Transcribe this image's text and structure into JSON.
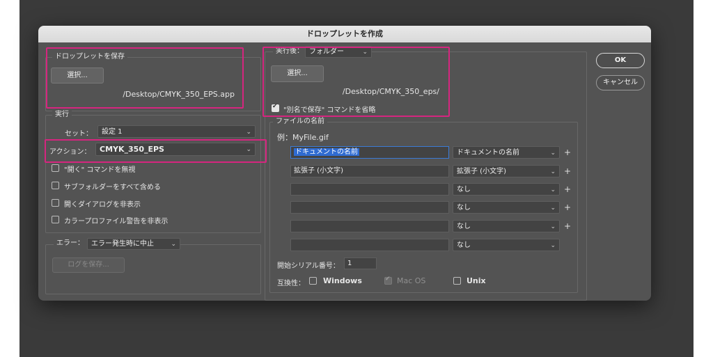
{
  "dialog": {
    "title": "ドロップレットを作成"
  },
  "save_droplet": {
    "legend": "ドロップレットを保存",
    "choose_label": "選択...",
    "path": "/Desktop/CMYK_350_EPS.app"
  },
  "run": {
    "legend": "実行",
    "set_label": "セット：",
    "set_value": "設定 1",
    "action_label": "アクション：",
    "action_value": "CMYK_350_EPS",
    "options": [
      "\"開く\" コマンドを無視",
      "サブフォルダーをすべて含める",
      "開くダイアログを非表示",
      "カラープロファイル警告を非表示"
    ]
  },
  "error": {
    "label": "エラー：",
    "value": "エラー発生時に中止",
    "log_button": "ログを保存..."
  },
  "destination": {
    "label": "実行後：",
    "value": "フォルダー",
    "choose_label": "選択...",
    "path": "/Desktop/CMYK_350_eps/",
    "override_label": "\"別名で保存\" コマンドを省略",
    "override_checked": true
  },
  "file_naming": {
    "legend": "ファイルの名前",
    "example": "例：MyFile.gif",
    "rows": [
      {
        "text": "ドキュメントの名前",
        "select": "ドキュメントの名前",
        "plus": "+"
      },
      {
        "text": "拡張子 (小文字)",
        "select": "拡張子 (小文字)",
        "plus": "+"
      },
      {
        "text": "",
        "select": "なし",
        "plus": "+"
      },
      {
        "text": "",
        "select": "なし",
        "plus": "+"
      },
      {
        "text": "",
        "select": "なし",
        "plus": "+"
      },
      {
        "text": "",
        "select": "なし",
        "plus": ""
      }
    ],
    "serial_label": "開始シリアル番号：",
    "serial_value": "1",
    "compat_label": "互換性：",
    "compat": [
      {
        "label": "Windows",
        "checked": false,
        "enabled": true
      },
      {
        "label": "Mac OS",
        "checked": true,
        "enabled": false
      },
      {
        "label": "Unix",
        "checked": false,
        "enabled": true
      }
    ]
  },
  "buttons": {
    "ok": "OK",
    "cancel": "キャンセル"
  },
  "colors": {
    "highlight": "#d6257f",
    "selection": "#2f6bd1",
    "dialog_bg": "#535353"
  }
}
